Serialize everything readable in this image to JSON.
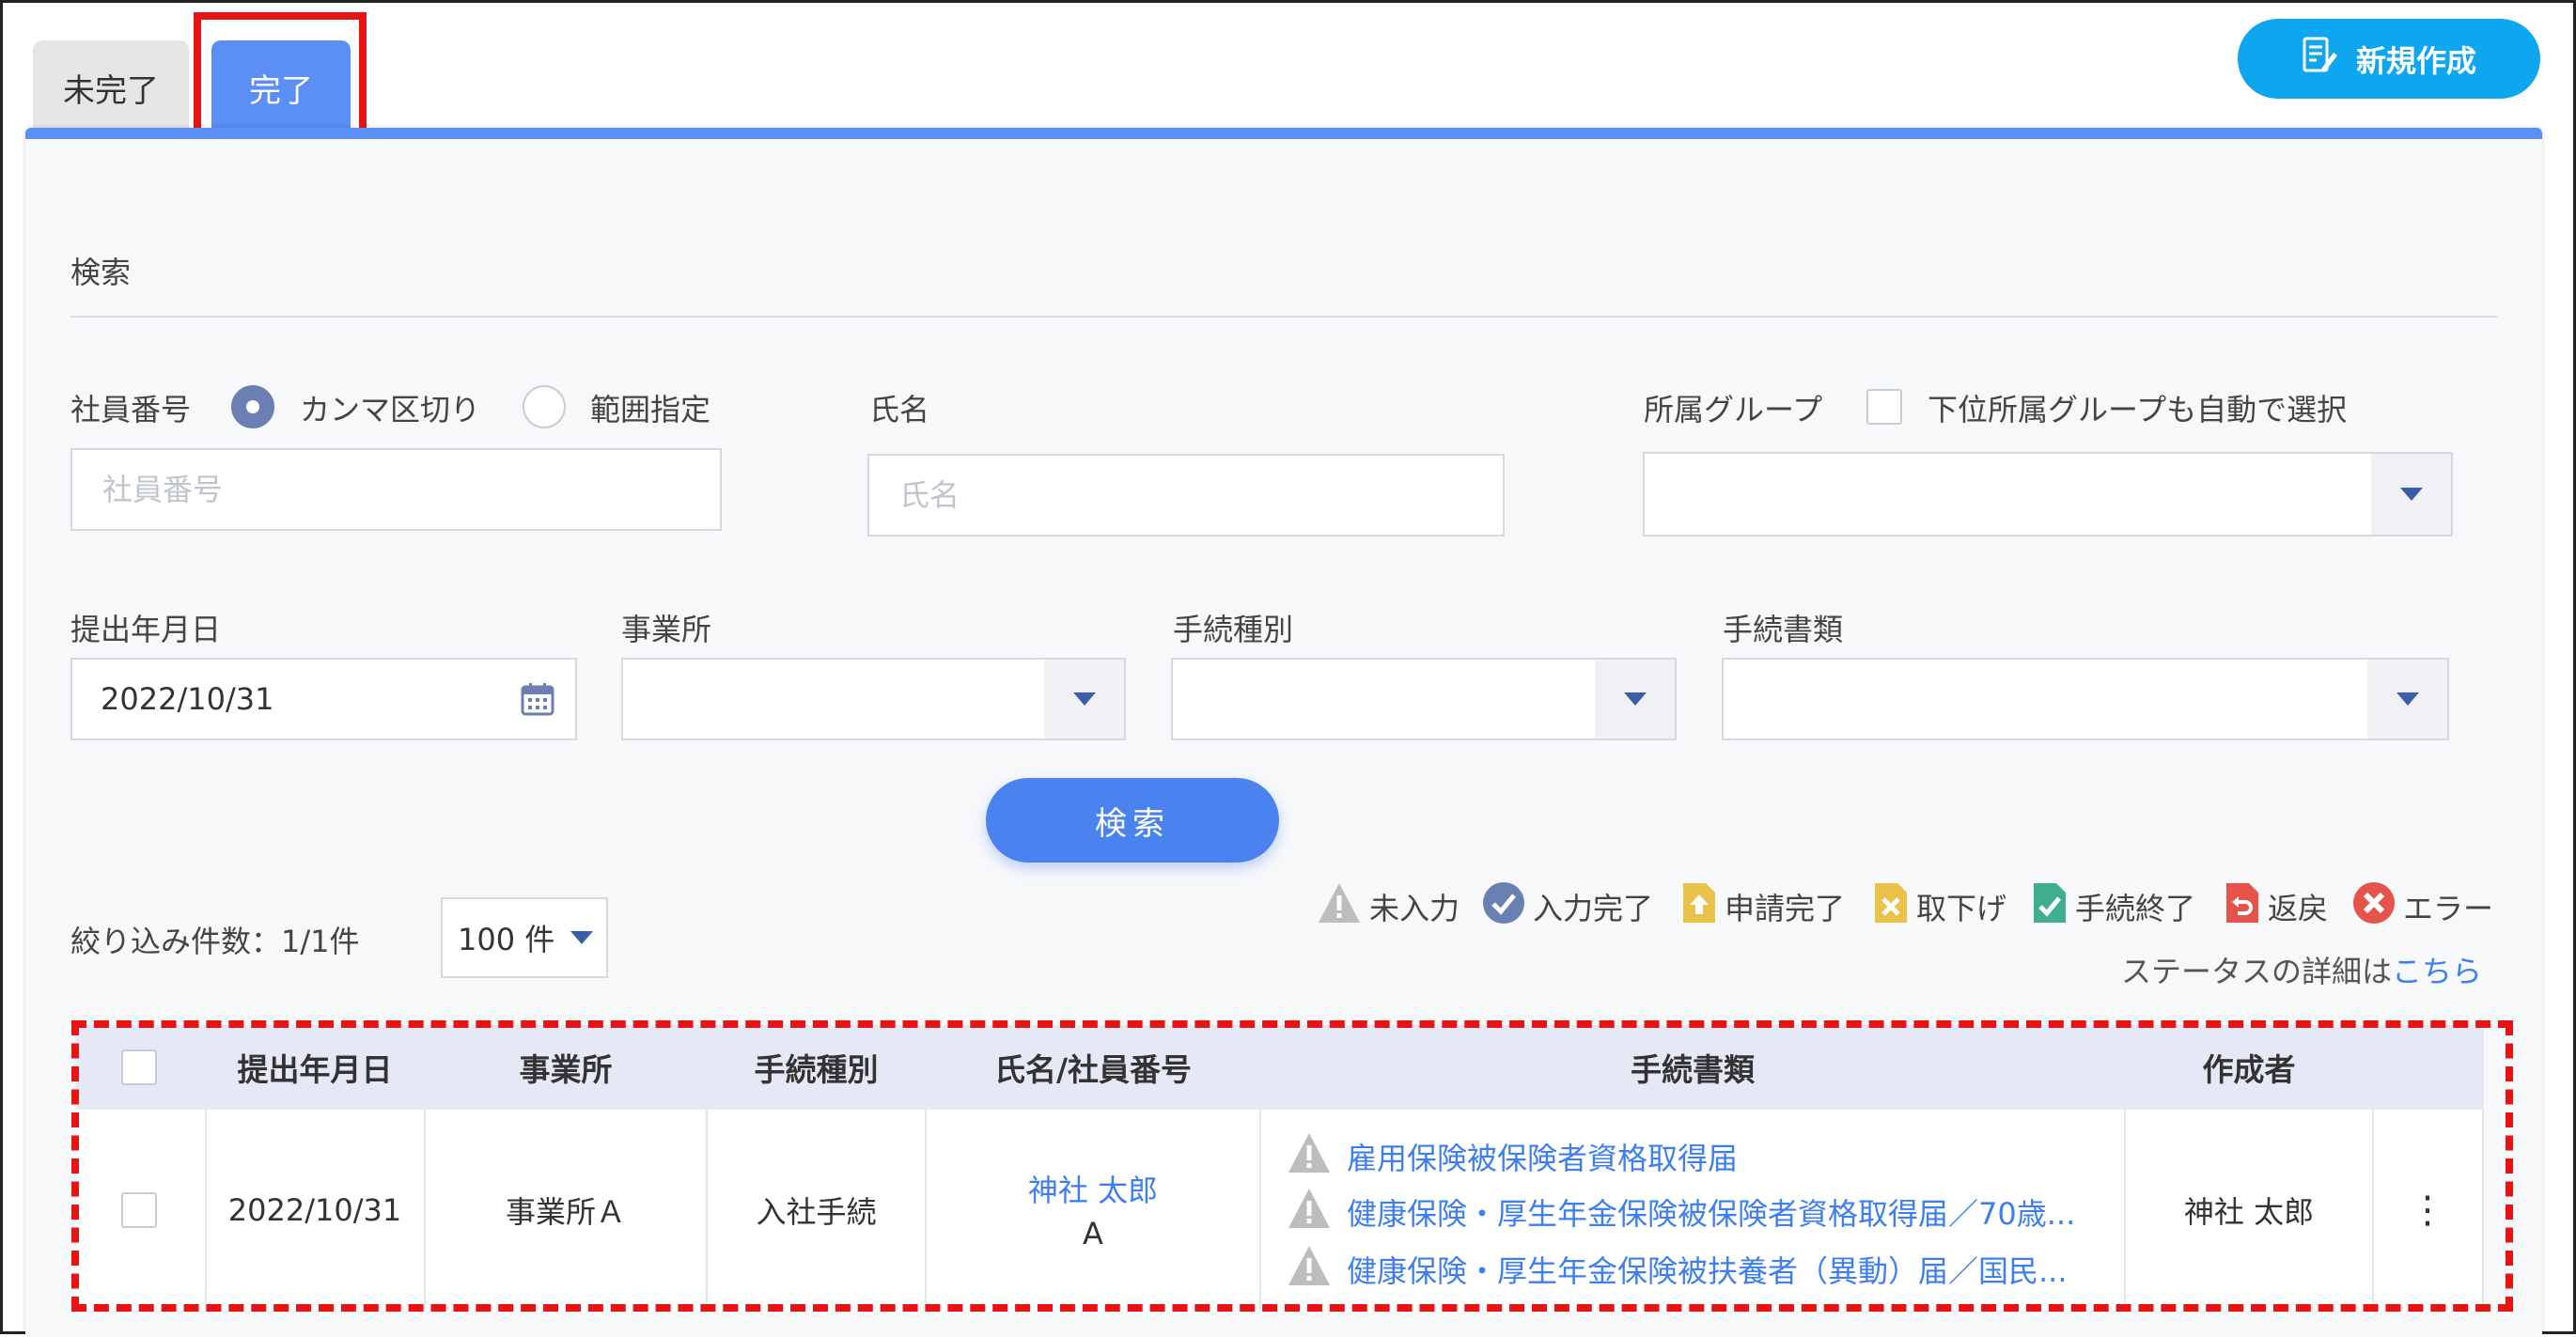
{
  "tabs": [
    {
      "label": "未完了"
    },
    {
      "label": "完了"
    }
  ],
  "new_button": {
    "label": "新規作成"
  },
  "search": {
    "title": "検索",
    "employee_number": {
      "label": "社員番号",
      "option_comma": "カンマ区切り",
      "option_range": "範囲指定",
      "placeholder": "社員番号",
      "selected": "カンマ区切り"
    },
    "name": {
      "label": "氏名",
      "placeholder": "氏名"
    },
    "group": {
      "label": "所属グループ",
      "checkbox_label": "下位所属グループも自動で選択",
      "value": ""
    },
    "submit_date": {
      "label": "提出年月日",
      "value": "2022/10/31"
    },
    "office": {
      "label": "事業所",
      "value": ""
    },
    "procedure_type": {
      "label": "手続種別",
      "value": ""
    },
    "procedure_doc": {
      "label": "手続書類",
      "value": ""
    },
    "button_label": "検索"
  },
  "results": {
    "count_text": "絞り込み件数：1/1件",
    "per_page": "100 件"
  },
  "legend": [
    {
      "label": "未入力",
      "icon": "warning-icon",
      "color": "#bdbdbd"
    },
    {
      "label": "入力完了",
      "icon": "check-circle-icon",
      "color": "#6b7fb3"
    },
    {
      "label": "申請完了",
      "icon": "upload-doc-icon",
      "color": "#e9c24a"
    },
    {
      "label": "取下げ",
      "icon": "withdraw-doc-icon",
      "color": "#e9c24a"
    },
    {
      "label": "手続終了",
      "icon": "done-doc-icon",
      "color": "#3fae8e"
    },
    {
      "label": "返戻",
      "icon": "return-doc-icon",
      "color": "#e5534b"
    },
    {
      "label": "エラー",
      "icon": "error-icon",
      "color": "#e5534b"
    }
  ],
  "status_detail": {
    "prefix": "ステータスの詳細は",
    "link": "こちら"
  },
  "table": {
    "headers": [
      "提出年月日",
      "事業所",
      "手続種別",
      "氏名/社員番号",
      "手続書類",
      "作成者"
    ],
    "rows": [
      {
        "date": "2022/10/31",
        "office": "事業所Ａ",
        "procedure": "入社手続",
        "name": "神社 太郎",
        "employee_no": "A",
        "documents": [
          "雇用保険被保険者資格取得届",
          "健康保険・厚生年金保険被保険者資格取得届／70歳...",
          "健康保険・厚生年金保険被扶養者（異動）届／国民..."
        ],
        "creator": "神社 太郎"
      }
    ]
  }
}
